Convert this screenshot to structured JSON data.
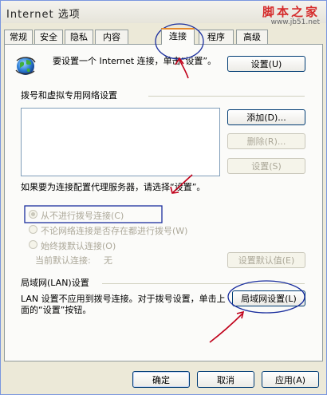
{
  "window": {
    "title": "Internet 选项"
  },
  "watermark": {
    "site": "脚本之家",
    "url": "www.jb51.net"
  },
  "tabs": [
    {
      "label": "常规"
    },
    {
      "label": "安全"
    },
    {
      "label": "隐私"
    },
    {
      "label": "内容"
    },
    {
      "label": "连接",
      "active": true
    },
    {
      "label": "程序"
    },
    {
      "label": "高级"
    }
  ],
  "setup": {
    "text": "要设置一个 Internet 连接，单击“设置”。",
    "button": "设置(U)"
  },
  "dialup": {
    "heading": "拨号和虚拟专用网络设置",
    "add": "添加(D)...",
    "remove": "删除(R)...",
    "settings": "设置(S)",
    "proxy_hint": "如果要为连接配置代理服务器，请选择“设置”。",
    "options": [
      {
        "label": "从不进行拨号连接(C)",
        "checked": true
      },
      {
        "label": "不论网络连接是否存在都进行拨号(W)",
        "checked": false
      },
      {
        "label": "始终拨默认连接(O)",
        "checked": false
      }
    ],
    "current_default_label": "当前默认连接:",
    "current_default_value": "无",
    "set_default": "设置默认值(E)"
  },
  "lan": {
    "heading": "局域网(LAN)设置",
    "text": "LAN 设置不应用到拨号连接。对于拨号设置，单击上面的“设置”按钮。",
    "button": "局域网设置(L)"
  },
  "footer": {
    "ok": "确定",
    "cancel": "取消",
    "apply": "应用(A)"
  },
  "colors": {
    "annotation": "#c0001a",
    "annotation_blue": "#1b2f9e",
    "active_tab_top": "#e68b2c"
  }
}
